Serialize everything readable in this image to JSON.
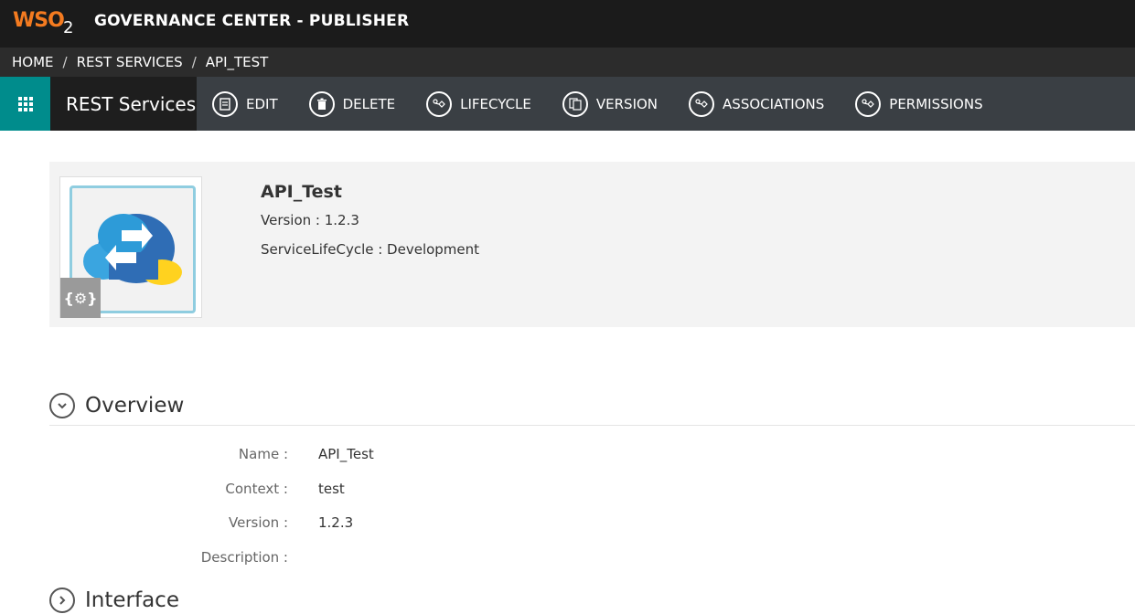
{
  "header": {
    "logo_text": "WSO",
    "logo_sub": "2",
    "title": "GOVERNANCE CENTER - PUBLISHER"
  },
  "breadcrumb": [
    "HOME",
    "REST SERVICES",
    "API_TEST"
  ],
  "actionbar": {
    "section": "REST Services",
    "actions": [
      {
        "label": "EDIT",
        "icon": "edit-icon"
      },
      {
        "label": "DELETE",
        "icon": "trash-icon"
      },
      {
        "label": "LIFECYCLE",
        "icon": "lifecycle-icon"
      },
      {
        "label": "VERSION",
        "icon": "version-icon"
      },
      {
        "label": "ASSOCIATIONS",
        "icon": "associations-icon"
      },
      {
        "label": "PERMISSIONS",
        "icon": "permissions-icon"
      }
    ]
  },
  "asset": {
    "name": "API_Test",
    "version": "Version : 1.2.3",
    "lifecycle": "ServiceLifeCycle : Development"
  },
  "overview": {
    "title": "Overview",
    "fields": [
      {
        "label": "Name :",
        "value": "API_Test"
      },
      {
        "label": "Context :",
        "value": "test"
      },
      {
        "label": "Version :",
        "value": "1.2.3"
      },
      {
        "label": "Description :",
        "value": ""
      }
    ]
  },
  "interface": {
    "title": "Interface"
  },
  "colors": {
    "accent": "#008c8c",
    "brand": "#f47b20",
    "topbar": "#1b1b1b",
    "actionbar": "#3a3f44"
  }
}
